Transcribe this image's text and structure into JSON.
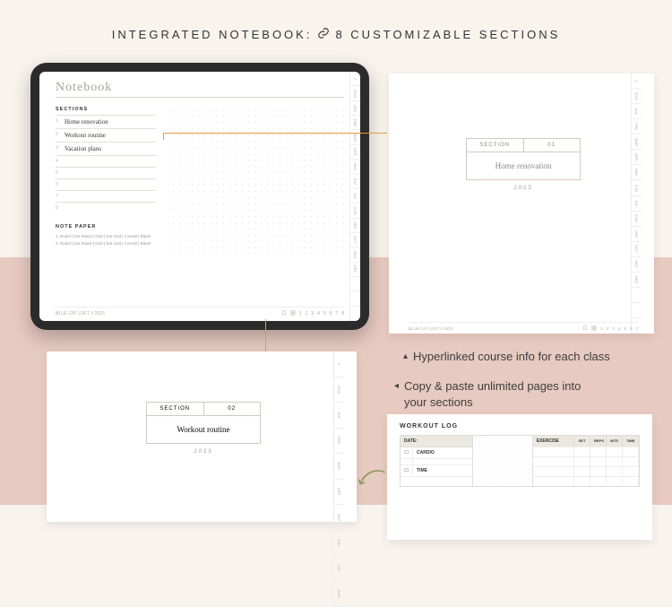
{
  "heading": {
    "part1": "INTEGRATED NOTEBOOK:",
    "part2": "8 CUSTOMIZABLE SECTIONS"
  },
  "notebook": {
    "title": "Notebook",
    "sections_label": "SECTIONS",
    "items": [
      {
        "n": "1",
        "text": "Home renovation"
      },
      {
        "n": "2",
        "text": "Workout routine"
      },
      {
        "n": "3",
        "text": "Vacation plans"
      },
      {
        "n": "4",
        "text": ""
      },
      {
        "n": "5",
        "text": ""
      },
      {
        "n": "6",
        "text": ""
      },
      {
        "n": "7",
        "text": ""
      },
      {
        "n": "8",
        "text": ""
      }
    ],
    "notepaper_label": "NOTE PAPER",
    "notepaper_row1": "1. Ruled | Dot Ruled | Grid | Dot Grid | Cornell | Blank",
    "notepaper_row2": "2. Ruled | Dot Ruled | Grid | Dot Grid | Cornell | Blank",
    "tabs": [
      "≡",
      "2023",
      "JAN",
      "FEB",
      "MAR",
      "APR",
      "MAY",
      "JUN",
      "JUL",
      "AUG",
      "SEP",
      "OCT",
      "NOV",
      "DEC",
      "",
      "",
      ""
    ],
    "footer_left": "BLUE CAT LOFT // 2023",
    "pager": [
      "1",
      "2",
      "3",
      "4",
      "5",
      "6",
      "7",
      "8"
    ]
  },
  "section_right": {
    "label": "SECTION",
    "num": "01",
    "title": "Home renovation",
    "year": "2023",
    "footer_left": "BLUE CAT LOFT // 2023",
    "pager": [
      "1",
      "2",
      "3",
      "4",
      "5",
      "6",
      "7"
    ]
  },
  "section_bottom": {
    "label": "SECTION",
    "num": "02",
    "title": "Workout routine",
    "year": "2023"
  },
  "captions": {
    "a": "Hyperlinked course info for each class",
    "b": "Copy & paste unlimited pages into your sections"
  },
  "workout": {
    "title": "WORKOUT LOG",
    "date": "DATE:",
    "cardio": "CARDIO",
    "time": "TIME",
    "exercise": "EXERCISE",
    "cols": [
      "SET",
      "REPS",
      "WTS",
      "TIME"
    ]
  }
}
